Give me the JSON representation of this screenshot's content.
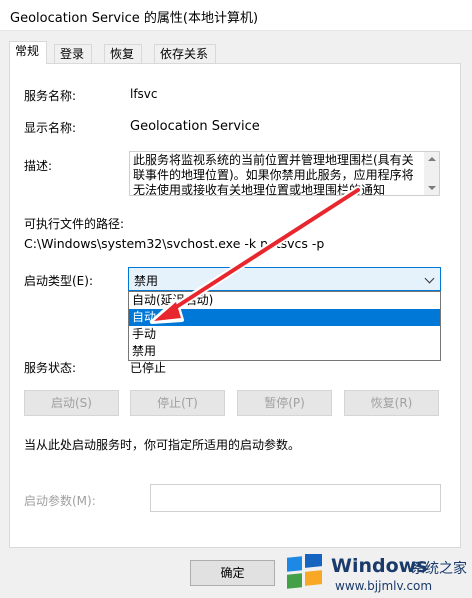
{
  "window": {
    "title": "Geolocation Service 的属性(本地计算机)"
  },
  "tabs": [
    "常规",
    "登录",
    "恢复",
    "依存关系"
  ],
  "fields": {
    "service_name_label": "服务名称:",
    "service_name_value": "lfsvc",
    "display_name_label": "显示名称:",
    "display_name_value": "Geolocation Service",
    "description_label": "描述:",
    "description_value": "此服务将监视系统的当前位置并管理地理围栏(具有关联事件的地理位置)。如果你禁用此服务，应用程序将无法使用或接收有关地理位置或地理围栏的通知",
    "path_label": "可执行文件的路径:",
    "path_value": "C:\\Windows\\system32\\svchost.exe -k netsvcs -p",
    "startup_type_label": "启动类型(E):",
    "startup_type_value": "禁用",
    "service_status_label": "服务状态:",
    "service_status_value": "已停止"
  },
  "startup_options": [
    "自动(延迟启动)",
    "自动",
    "手动",
    "禁用"
  ],
  "startup_selected_index": 1,
  "buttons": {
    "start": "启动(S)",
    "stop": "停止(T)",
    "pause": "暂停(P)",
    "resume": "恢复(R)",
    "ok": "确定"
  },
  "hint": "当从此处启动服务时，你可指定所适用的启动参数。",
  "start_params_label": "启动参数(M):",
  "watermark": {
    "brand": "Windows",
    "suffix": "系统之家",
    "url": "www.bjjmlv.com"
  },
  "colors": {
    "accent": "#0078d7",
    "annotation_arrow": "#e8262d"
  }
}
